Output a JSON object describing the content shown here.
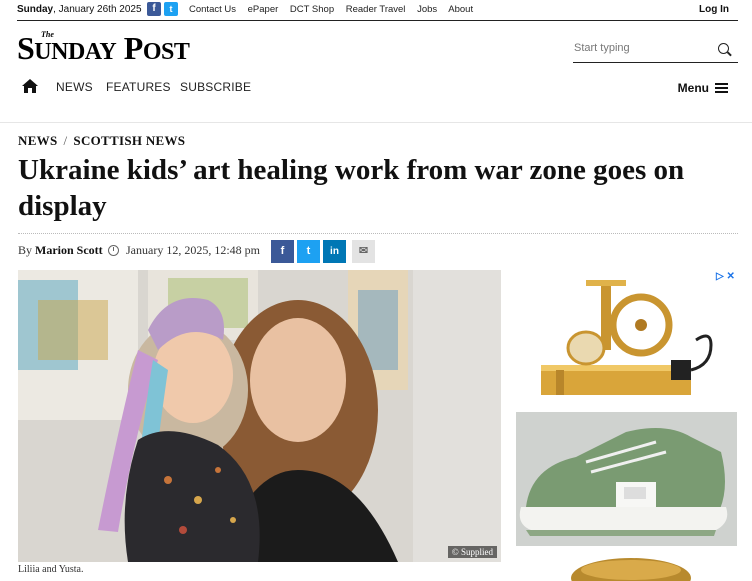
{
  "topbar": {
    "day": "Sunday",
    "date": ", January 26th 2025",
    "facebook": "f",
    "twitter": "t",
    "links": [
      "Contact Us",
      "ePaper",
      "DCT Shop",
      "Reader Travel",
      "Jobs",
      "About"
    ],
    "login": "Log In"
  },
  "logo": {
    "the": "The",
    "first": "S",
    "first_rest": "UNDAY",
    "second": "P",
    "second_rest": "OST"
  },
  "search": {
    "placeholder": "Start typing"
  },
  "nav": {
    "items": [
      "NEWS",
      "FEATURES",
      "SUBSCRIBE"
    ],
    "menu": "Menu"
  },
  "article": {
    "breadcrumb": [
      "NEWS",
      "SCOTTISH NEWS"
    ],
    "breadcrumb_sep": "/",
    "headline": "Ukraine kids’ art healing work from war zone goes on display",
    "by": "By",
    "author": "Marion Scott",
    "date": "January 12, 2025, 12:48 pm",
    "share": {
      "facebook": "f",
      "twitter": "t",
      "linkedin": "in",
      "email": "✉"
    },
    "image_credit": "© Supplied",
    "caption": "Liliia and Yusta."
  },
  "ads": {
    "adchoices": "▷ ✕"
  },
  "colors": {
    "facebook": "#3b5998",
    "twitter": "#1da1f2",
    "linkedin": "#0077b5"
  }
}
